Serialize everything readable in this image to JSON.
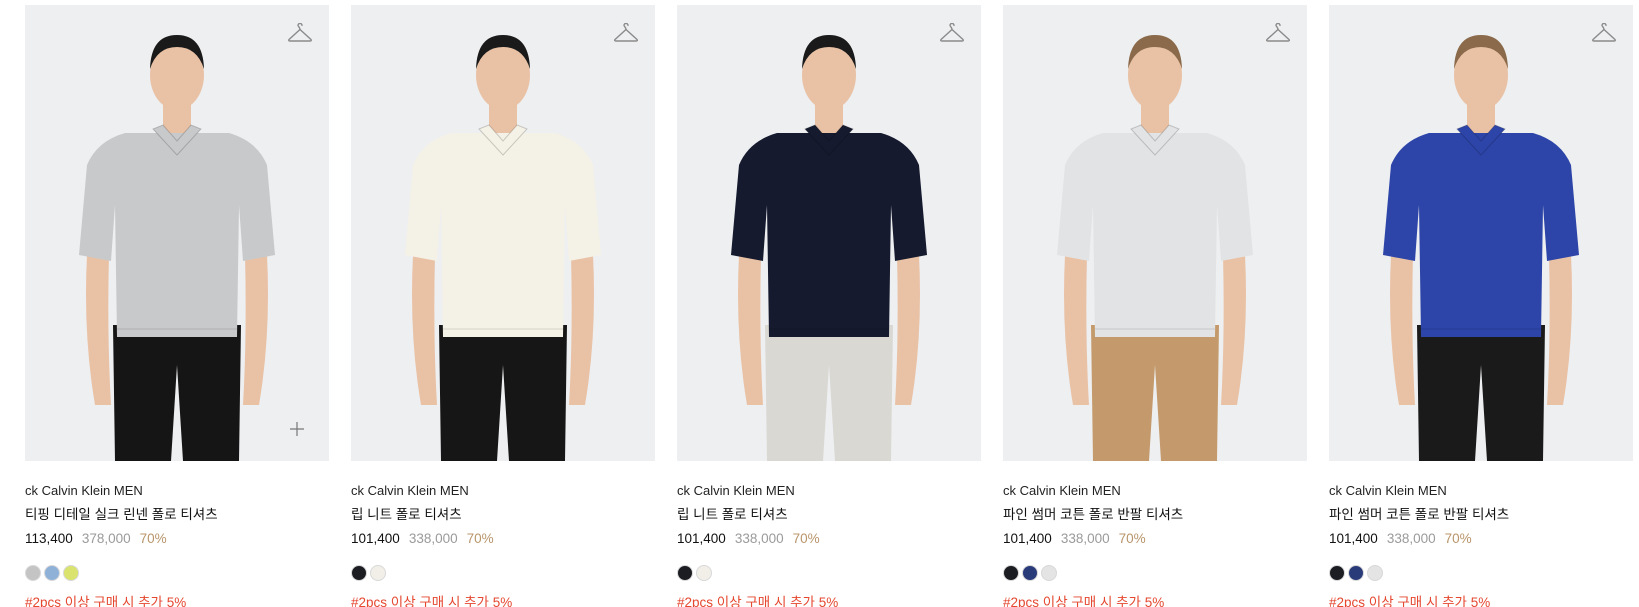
{
  "products": [
    {
      "brand": "ck Calvin Klein MEN",
      "name": "티핑 디테일 실크 린넨 폴로 티셔츠",
      "price": "113,400",
      "original_price": "378,000",
      "discount": "70%",
      "swatches": [
        "#c4c4c4",
        "#8fb1d8",
        "#d9e36e"
      ],
      "promo": "#2pcs 이상 구매 시 추가 5%",
      "shirt_color": "#c8c9cb",
      "pants_color": "#151515",
      "hair_color": "#1a1a1a",
      "has_plus": true
    },
    {
      "brand": "ck Calvin Klein MEN",
      "name": "립 니트 폴로 티셔츠",
      "price": "101,400",
      "original_price": "338,000",
      "discount": "70%",
      "swatches": [
        "#1b1d22",
        "#f1efe8"
      ],
      "promo": "#2pcs 이상 구매 시 추가 5%",
      "shirt_color": "#f4f1e6",
      "pants_color": "#161616",
      "hair_color": "#1a1a1a",
      "has_plus": false
    },
    {
      "brand": "ck Calvin Klein MEN",
      "name": "립 니트 폴로 티셔츠",
      "price": "101,400",
      "original_price": "338,000",
      "discount": "70%",
      "swatches": [
        "#1b1d22",
        "#f1efe8"
      ],
      "promo": "#2pcs 이상 구매 시 추가 5%",
      "shirt_color": "#151a2e",
      "pants_color": "#d9d8d3",
      "hair_color": "#1a1a1a",
      "has_plus": false
    },
    {
      "brand": "ck Calvin Klein MEN",
      "name": "파인 썸머 코튼 폴로 반팔 티셔츠",
      "price": "101,400",
      "original_price": "338,000",
      "discount": "70%",
      "swatches": [
        "#1b1d22",
        "#2a3b7a",
        "#e4e4e4"
      ],
      "promo": "#2pcs 이상 구매 시 추가 5%",
      "shirt_color": "#e2e3e4",
      "pants_color": "#c49a6c",
      "hair_color": "#8a6a4a",
      "has_plus": false
    },
    {
      "brand": "ck Calvin Klein MEN",
      "name": "파인 썸머 코튼 폴로 반팔 티셔츠",
      "price": "101,400",
      "original_price": "338,000",
      "discount": "70%",
      "swatches": [
        "#1b1d22",
        "#2a3b7a",
        "#e4e4e4"
      ],
      "promo": "#2pcs 이상 구매 시 추가 5%",
      "shirt_color": "#2d45a8",
      "pants_color": "#1a1a1a",
      "hair_color": "#8a6a4a",
      "has_plus": false
    }
  ],
  "icons": {
    "wishlist": "hanger-icon",
    "add": "plus-icon"
  },
  "colors": {
    "promo": "#e5472f",
    "discount": "#b8956a",
    "original_price": "#9a9a9a",
    "image_bg": "#eeeff1"
  }
}
